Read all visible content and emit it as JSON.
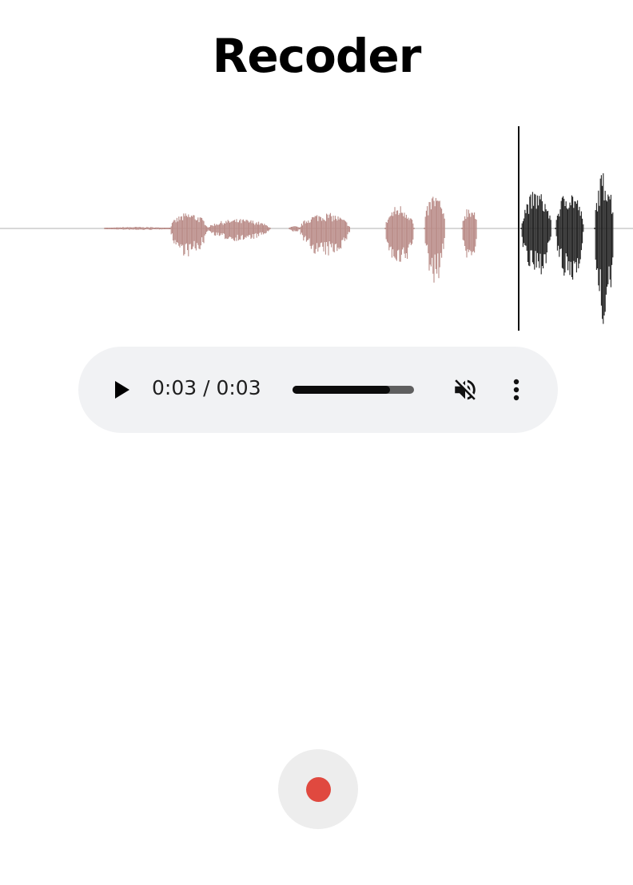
{
  "app": {
    "title": "Recoder"
  },
  "waveform": {
    "played_color": "#b98a86",
    "unplayed_color": "#1e1e1e",
    "baseline_color": "#cccccc",
    "cursor_color": "#111111",
    "played_fraction": 0.82
  },
  "player": {
    "time_display": "0:03 / 0:03",
    "progress_fraction": 0.8,
    "muted": true,
    "play_icon": "play-icon",
    "mute_icon": "volume-off-icon",
    "more_icon": "more-vertical-icon"
  },
  "recorder": {
    "record_icon": "record-icon",
    "record_color": "#e0493f"
  }
}
